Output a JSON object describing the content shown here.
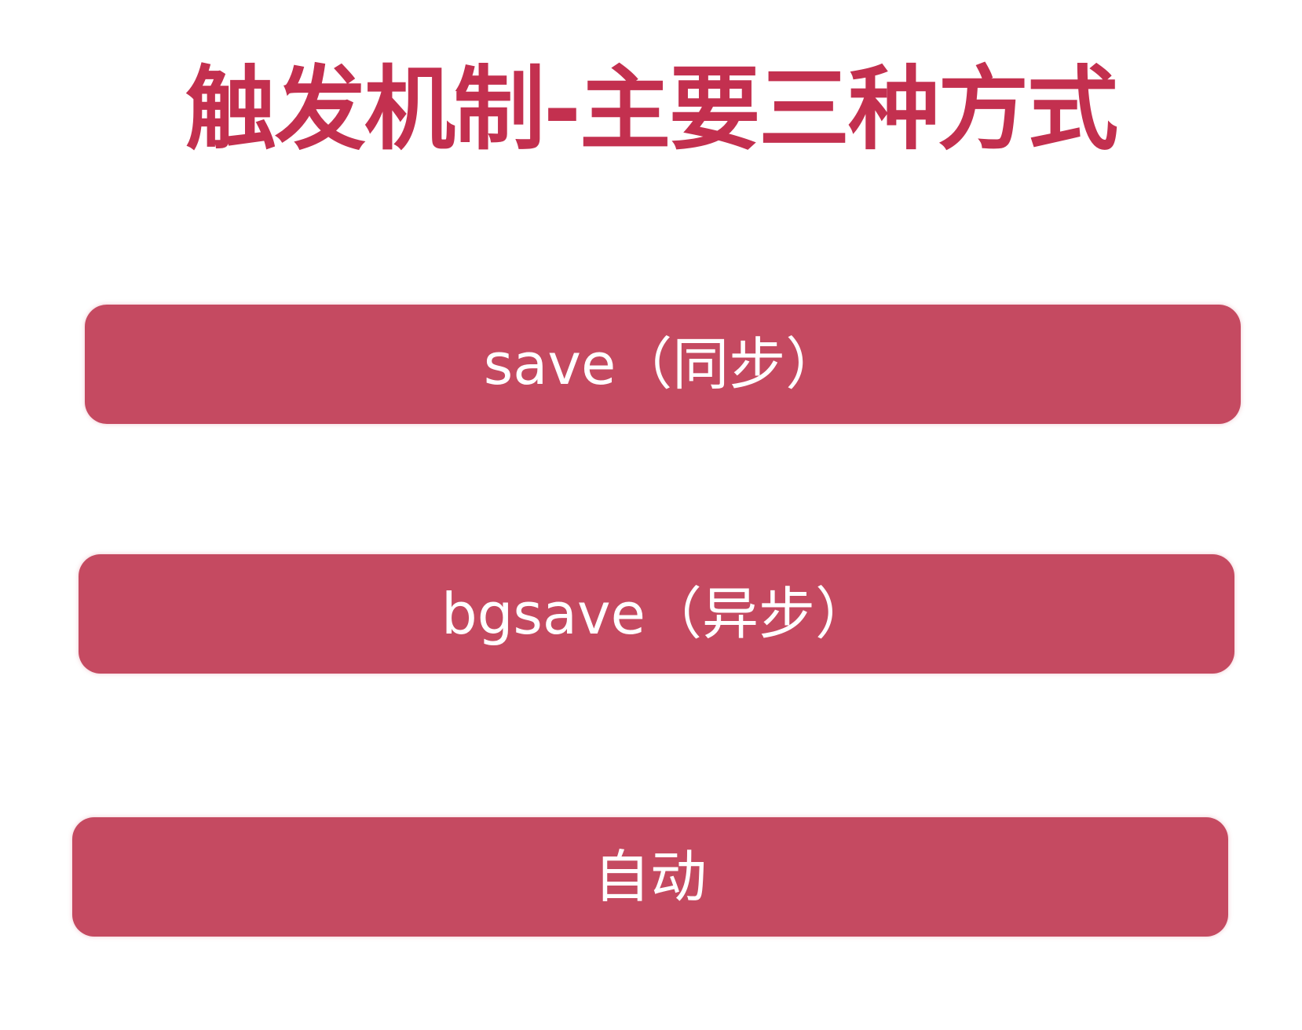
{
  "slide": {
    "title": "触发机制-主要三种方式",
    "options": [
      {
        "label": "save（同步）"
      },
      {
        "label": "bgsave（异步）"
      },
      {
        "label": "自动"
      }
    ]
  },
  "colors": {
    "title": "#c3304f",
    "pill_background": "#c54a61",
    "pill_text": "#ffffff",
    "background": "#ffffff"
  }
}
